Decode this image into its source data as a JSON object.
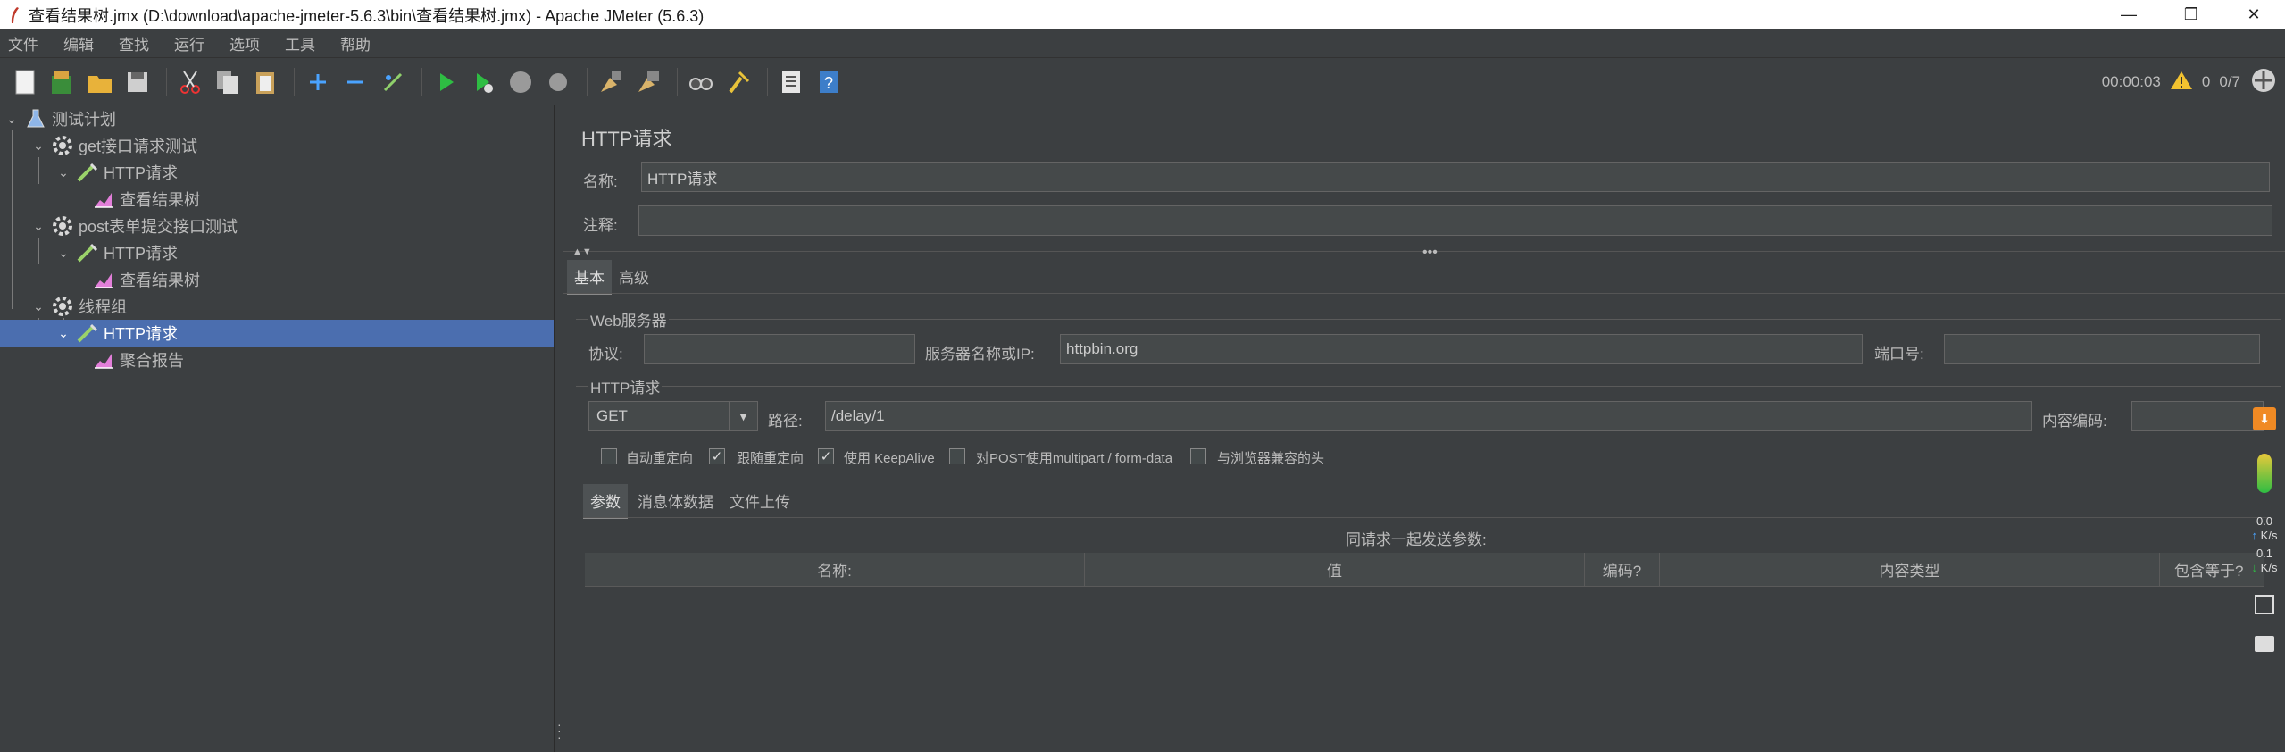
{
  "window": {
    "title": "查看结果树.jmx (D:\\download\\apache-jmeter-5.6.3\\bin\\查看结果树.jmx) - Apache JMeter (5.6.3)",
    "minimize": "—",
    "restore": "❐",
    "close": "✕"
  },
  "menu": [
    "文件",
    "编辑",
    "查找",
    "运行",
    "选项",
    "工具",
    "帮助"
  ],
  "toolbar": {
    "buttons": [
      "new-icon",
      "templates-icon",
      "open-icon",
      "save-icon",
      "cut-icon",
      "copy-icon",
      "paste-icon",
      "expand-icon",
      "collapse-icon",
      "toggle-icon",
      "start-icon",
      "start-no-pauses-icon",
      "stop-icon",
      "shutdown-icon",
      "clear-icon",
      "clear-all-icon",
      "search-icon",
      "reset-search-icon",
      "function-helper-icon",
      "help-icon"
    ],
    "elapsed": "00:00:03",
    "warnings": "0",
    "threads": "0/7"
  },
  "tree": [
    {
      "label": "测试计划",
      "icon": "test-plan-icon",
      "level": 0,
      "expanded": true
    },
    {
      "label": "get接口请求测试",
      "icon": "thread-group-gear-icon",
      "level": 1,
      "expanded": true
    },
    {
      "label": "HTTP请求",
      "icon": "sampler-pipette-icon",
      "level": 2,
      "expanded": true
    },
    {
      "label": "查看结果树",
      "icon": "listener-chart-icon",
      "level": 3
    },
    {
      "label": "post表单提交接口测试",
      "icon": "thread-group-gear-icon",
      "level": 1,
      "expanded": true
    },
    {
      "label": "HTTP请求",
      "icon": "sampler-pipette-icon",
      "level": 2,
      "expanded": true
    },
    {
      "label": "查看结果树",
      "icon": "listener-chart-icon",
      "level": 3
    },
    {
      "label": "线程组",
      "icon": "thread-group-gear-icon",
      "level": 1,
      "expanded": true
    },
    {
      "label": "HTTP请求",
      "icon": "sampler-pipette-icon",
      "level": 2,
      "expanded": true,
      "selected": true
    },
    {
      "label": "聚合报告",
      "icon": "listener-chart-icon",
      "level": 3
    }
  ],
  "panel": {
    "title": "HTTP请求",
    "name_label": "名称:",
    "name_value": "HTTP请求",
    "comment_label": "注释:",
    "comment_value": "",
    "tabs": [
      "基本",
      "高级"
    ],
    "web_server_group": "Web服务器",
    "protocol_label": "协议:",
    "protocol_value": "",
    "server_label": "服务器名称或IP:",
    "server_value": "httpbin.org",
    "port_label": "端口号:",
    "port_value": "",
    "http_group": "HTTP请求",
    "method": "GET",
    "path_label": "路径:",
    "path_value": "/delay/1",
    "encoding_label": "内容编码:",
    "encoding_value": "",
    "checkboxes": [
      {
        "label": "自动重定向",
        "checked": false
      },
      {
        "label": "跟随重定向",
        "checked": true
      },
      {
        "label": "使用 KeepAlive",
        "checked": true
      },
      {
        "label": "对POST使用multipart / form-data",
        "checked": false
      },
      {
        "label": "与浏览器兼容的头",
        "checked": false
      }
    ],
    "sub_tabs": [
      "参数",
      "消息体数据",
      "文件上传"
    ],
    "params_caption": "同请求一起发送参数:",
    "params_columns": [
      "名称:",
      "值",
      "编码?",
      "内容类型",
      "包含等于?"
    ]
  },
  "side_strip": {
    "up_rate": "0.0",
    "up_unit": "K/s",
    "down_rate": "0.1",
    "down_unit": "K/s"
  }
}
